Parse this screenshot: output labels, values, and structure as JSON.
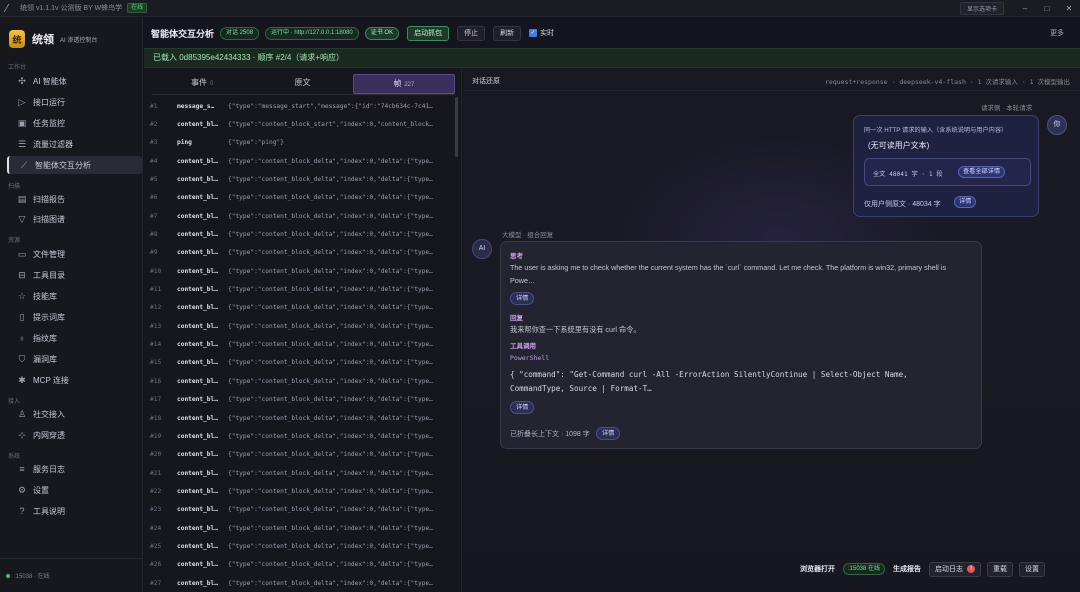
{
  "window": {
    "title": "统领 v1.1.1v 公测版 BY W蜂鸟学",
    "online_badge": "在线",
    "settings_button": "显示选项卡"
  },
  "brand": {
    "name": "统领",
    "subtitle": "AI 渗透控制台",
    "logo_glyph": "统"
  },
  "sidebar": {
    "sections": [
      {
        "label": "工作台",
        "items": [
          {
            "label": "AI 智能体",
            "icon": "sparkle-icon"
          },
          {
            "label": "接口运行",
            "icon": "play-icon"
          },
          {
            "label": "任务监控",
            "icon": "clipboard-icon"
          },
          {
            "label": "流量过滤器",
            "icon": "filter-lines-icon"
          },
          {
            "label": "智能体交互分析",
            "icon": "chart-icon",
            "active": true
          }
        ]
      },
      {
        "label": "扫描",
        "items": [
          {
            "label": "扫描报告",
            "icon": "report-icon"
          },
          {
            "label": "扫描图谱",
            "icon": "funnel-icon"
          }
        ]
      },
      {
        "label": "资源",
        "items": [
          {
            "label": "文件管理",
            "icon": "folder-icon"
          },
          {
            "label": "工具目录",
            "icon": "toolbox-icon"
          },
          {
            "label": "技能库",
            "icon": "star-icon"
          },
          {
            "label": "提示词库",
            "icon": "notebook-icon"
          },
          {
            "label": "指纹库",
            "icon": "bulb-icon"
          },
          {
            "label": "漏洞库",
            "icon": "shield-icon"
          },
          {
            "label": "MCP 连接",
            "icon": "plug-icon"
          }
        ]
      },
      {
        "label": "接入",
        "items": [
          {
            "label": "社交接入",
            "icon": "user-icon"
          },
          {
            "label": "内网穿透",
            "icon": "network-icon"
          }
        ]
      },
      {
        "label": "系统",
        "items": [
          {
            "label": "服务日志",
            "icon": "log-icon"
          },
          {
            "label": "设置",
            "icon": "gear-icon"
          },
          {
            "label": "工具说明",
            "icon": "help-icon"
          }
        ]
      }
    ],
    "footer_status": ":15038 · 在线"
  },
  "toolbar": {
    "title": "智能体交互分析",
    "pill_session": "对话 2508",
    "pill_running": "运行中 · http://127.0.0.1:18080",
    "pill_cert": "证书 OK",
    "btn_start": "启动抓包",
    "btn_stop": "停止",
    "btn_refresh": "刷新",
    "realtime_label": "实时",
    "realtime_checked": true,
    "more": "更多"
  },
  "status_strip": "已载入 0d85395e42434333 · 顺序 #2/4（请求+响应）",
  "left_pane": {
    "tabs": [
      {
        "label": "事件",
        "count": "0"
      },
      {
        "label": "原文",
        "count": ""
      },
      {
        "label": "帧",
        "count": "227",
        "active": true
      }
    ],
    "rows": [
      {
        "n": "#1",
        "type": "message_s…",
        "json": "{\"type\":\"message_start\",\"message\":{\"id\":\"74cb634c-7c41…"
      },
      {
        "n": "#2",
        "type": "content_bl…",
        "json": "{\"type\":\"content_block_start\",\"index\":0,\"content_block…"
      },
      {
        "n": "#3",
        "type": "ping",
        "json": "{\"type\":\"ping\"}"
      },
      {
        "n": "#4",
        "type": "content_bl…",
        "json": "{\"type\":\"content_block_delta\",\"index\":0,\"delta\":{\"type…"
      },
      {
        "n": "#5",
        "type": "content_bl…",
        "json": "{\"type\":\"content_block_delta\",\"index\":0,\"delta\":{\"type…"
      },
      {
        "n": "#6",
        "type": "content_bl…",
        "json": "{\"type\":\"content_block_delta\",\"index\":0,\"delta\":{\"type…"
      },
      {
        "n": "#7",
        "type": "content_bl…",
        "json": "{\"type\":\"content_block_delta\",\"index\":0,\"delta\":{\"type…"
      },
      {
        "n": "#8",
        "type": "content_bl…",
        "json": "{\"type\":\"content_block_delta\",\"index\":0,\"delta\":{\"type…"
      },
      {
        "n": "#9",
        "type": "content_bl…",
        "json": "{\"type\":\"content_block_delta\",\"index\":0,\"delta\":{\"type…"
      },
      {
        "n": "#10",
        "type": "content_bl…",
        "json": "{\"type\":\"content_block_delta\",\"index\":0,\"delta\":{\"type…"
      },
      {
        "n": "#11",
        "type": "content_bl…",
        "json": "{\"type\":\"content_block_delta\",\"index\":0,\"delta\":{\"type…"
      },
      {
        "n": "#12",
        "type": "content_bl…",
        "json": "{\"type\":\"content_block_delta\",\"index\":0,\"delta\":{\"type…"
      },
      {
        "n": "#13",
        "type": "content_bl…",
        "json": "{\"type\":\"content_block_delta\",\"index\":0,\"delta\":{\"type…"
      },
      {
        "n": "#14",
        "type": "content_bl…",
        "json": "{\"type\":\"content_block_delta\",\"index\":0,\"delta\":{\"type…"
      },
      {
        "n": "#15",
        "type": "content_bl…",
        "json": "{\"type\":\"content_block_delta\",\"index\":0,\"delta\":{\"type…"
      },
      {
        "n": "#16",
        "type": "content_bl…",
        "json": "{\"type\":\"content_block_delta\",\"index\":0,\"delta\":{\"type…"
      },
      {
        "n": "#17",
        "type": "content_bl…",
        "json": "{\"type\":\"content_block_delta\",\"index\":0,\"delta\":{\"type…"
      },
      {
        "n": "#18",
        "type": "content_bl…",
        "json": "{\"type\":\"content_block_delta\",\"index\":0,\"delta\":{\"type…"
      },
      {
        "n": "#19",
        "type": "content_bl…",
        "json": "{\"type\":\"content_block_delta\",\"index\":0,\"delta\":{\"type…"
      },
      {
        "n": "#20",
        "type": "content_bl…",
        "json": "{\"type\":\"content_block_delta\",\"index\":0,\"delta\":{\"type…"
      },
      {
        "n": "#21",
        "type": "content_bl…",
        "json": "{\"type\":\"content_block_delta\",\"index\":0,\"delta\":{\"type…"
      },
      {
        "n": "#22",
        "type": "content_bl…",
        "json": "{\"type\":\"content_block_delta\",\"index\":0,\"delta\":{\"type…"
      },
      {
        "n": "#23",
        "type": "content_bl…",
        "json": "{\"type\":\"content_block_delta\",\"index\":0,\"delta\":{\"type…"
      },
      {
        "n": "#24",
        "type": "content_bl…",
        "json": "{\"type\":\"content_block_delta\",\"index\":0,\"delta\":{\"type…"
      },
      {
        "n": "#25",
        "type": "content_bl…",
        "json": "{\"type\":\"content_block_delta\",\"index\":0,\"delta\":{\"type…"
      },
      {
        "n": "#26",
        "type": "content_bl…",
        "json": "{\"type\":\"content_block_delta\",\"index\":0,\"delta\":{\"type…"
      },
      {
        "n": "#27",
        "type": "content_bl…",
        "json": "{\"type\":\"content_block_delta\",\"index\":0,\"delta\":{\"type…"
      }
    ]
  },
  "right_pane": {
    "title": "对话还原",
    "meta": "request+response · deepseek-v4-flash · 1 次请求输入 · 1 次模型输出",
    "request": {
      "side_label": "请求侧 · 本轮请求",
      "line1": "同一次 HTTP 请求的输入（含系统说明与用户内容）",
      "line2": "(无可读用户文本)",
      "summary": "全文 48041 字 · 1 段",
      "view_all_button": "查看全部详情",
      "footer": "仅用户侧原文 · 48034 字",
      "detail_button": "详情",
      "avatar": "你"
    },
    "response": {
      "label": "大模型 · 组合回复",
      "avatar": "AI",
      "think_heading": "思考",
      "think_text": "The user is asking me to check whether the current system has the `curl` command. Let me check. The platform is win32, primary shell is Powe…",
      "think_detail": "详情",
      "reply_heading": "回复",
      "reply_text": "我来帮你查一下系统里有没有 curl 命令。",
      "tool_heading": "工具调用",
      "tool_lang": "PowerShell",
      "tool_code_line1": "{ \"command\": \"Get-Command curl -All -ErrorAction SilentlyContinue | Select-Object Name,",
      "tool_code_line2": "CommandType, Source | Format-T…",
      "tool_detail": "详情",
      "fold_text": "已折叠长上下文 · 1098 字",
      "fold_detail": "详情"
    }
  },
  "bottom_bar": {
    "browser_open": "浏览器打开",
    "port_pill": ":15038 在线",
    "report": "生成报告",
    "start_log": "启动日志",
    "log_badge": "!",
    "rescan": "重载",
    "settings": "设置"
  }
}
